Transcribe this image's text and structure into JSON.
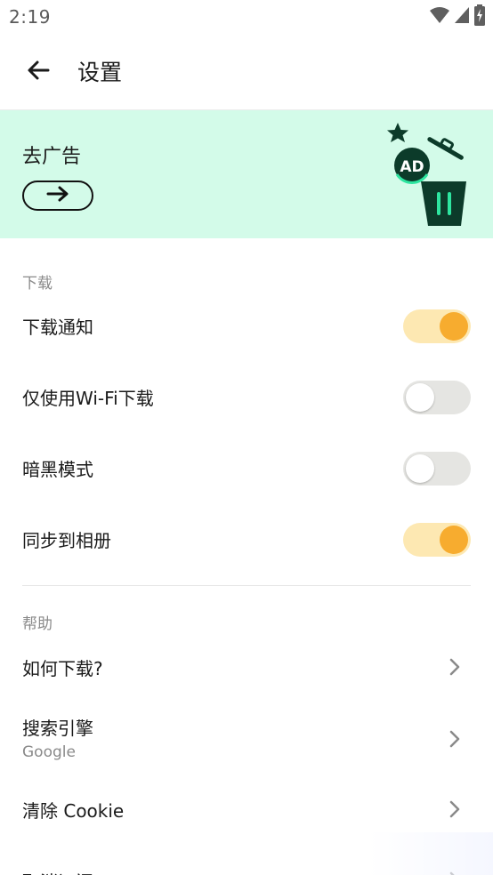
{
  "status_bar": {
    "time": "2:19",
    "icons": [
      "wifi-icon",
      "cell-signal-icon",
      "battery-charging-icon"
    ]
  },
  "app_bar": {
    "title": "设置",
    "back_icon": "arrow-left-icon"
  },
  "banner": {
    "title": "去广告",
    "button_icon": "arrow-right-icon",
    "illustration": "ad-trash-illustration",
    "illustration_badge_text": "AD",
    "background_color": "#d3fbe9"
  },
  "sections": {
    "download": {
      "header": "下载",
      "items": [
        {
          "label": "下载通知",
          "enabled": true
        },
        {
          "label": "仅使用Wi-Fi下载",
          "enabled": false
        },
        {
          "label": "暗黑模式",
          "enabled": false
        },
        {
          "label": "同步到相册",
          "enabled": true
        }
      ]
    },
    "help": {
      "header": "帮助",
      "items": [
        {
          "label": "如何下载?",
          "subtitle": ""
        },
        {
          "label": "搜索引擎",
          "subtitle": "Google"
        },
        {
          "label": "清除 Cookie",
          "subtitle": ""
        },
        {
          "label": "取消订阅",
          "subtitle": ""
        }
      ]
    }
  },
  "colors": {
    "toggle_on_track": "#fde8b2",
    "toggle_on_knob": "#f7ac2f",
    "toggle_off_track": "#e5e5e2",
    "illustration_green": "#0c3b2a"
  }
}
